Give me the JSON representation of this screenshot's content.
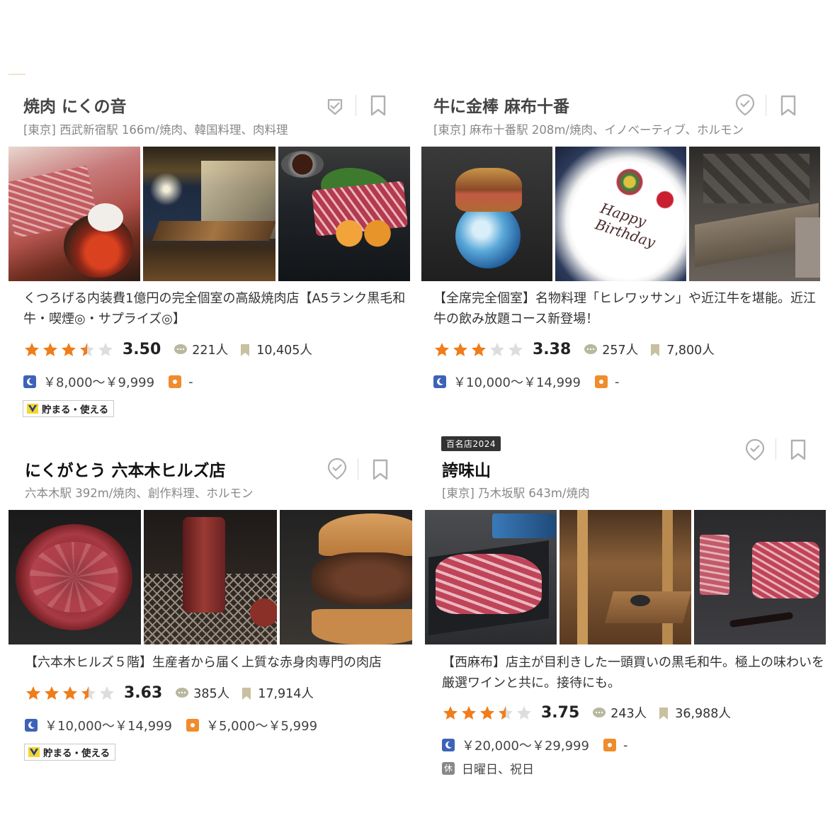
{
  "cards": [
    {
      "title": "焼肉 にくの音",
      "meta": "[東京] 西武新宿駅 166m/焼肉、韓国料理、肉料理",
      "description": "くつろげる内装費1億円の完全個室の高級焼肉店【A5ランク黒毛和牛・喫煙◎・サプライズ◎】",
      "rating": 3.5,
      "score": "3.50",
      "reviews": "221人",
      "bookmarks": "10,405人",
      "dinner_price": "￥8,000～￥9,999",
      "lunch_price": "-",
      "tpoint": "貯まる・使える",
      "photos": [
        "wagyu-plate-photo",
        "private-room-photo",
        "meat-uni-photo"
      ]
    },
    {
      "title": "牛に金棒 麻布十番",
      "meta": "[東京] 麻布十番駅 208m/焼肉、イノベーティブ、ホルモン",
      "description": "【全席完全個室】名物料理「ヒレワッサン」や近江牛を堪能。近江牛の飲み放題コース新登場！",
      "rating": 3.38,
      "score": "3.38",
      "reviews": "257人",
      "bookmarks": "7,800人",
      "dinner_price": "￥10,000～￥14,999",
      "lunch_price": "-",
      "photos": [
        "hirewassan-photo",
        "birthday-plate-photo",
        "dining-table-photo"
      ],
      "plate_text": "Happy Birthday"
    },
    {
      "title": "にくがとう 六本木ヒルズ店",
      "meta": "六本木駅 392m/焼肉、創作料理、ホルモン",
      "description": "【六本木ヒルズ５階】生産者から届く上質な赤身肉専門の肉店",
      "rating": 3.63,
      "score": "3.63",
      "reviews": "385人",
      "bookmarks": "17,914人",
      "dinner_price": "￥10,000～￥14,999",
      "lunch_price": "￥5,000～￥5,999",
      "tpoint": "貯まる・使える",
      "photos": [
        "sliced-beef-photo",
        "grill-photo",
        "burger-photo"
      ]
    },
    {
      "badge": "百名店2024",
      "title": "誇味山",
      "meta": "[東京] 乃木坂駅 643m/焼肉",
      "description": "【西麻布】店主が目利きした一頭買いの黒毛和牛。極上の味わいを厳選ワインと共に。接待にも。",
      "rating": 3.75,
      "score": "3.75",
      "reviews": "243人",
      "bookmarks": "36,988人",
      "dinner_price": "￥20,000～￥29,999",
      "lunch_price": "-",
      "holiday": "日曜日、祝日",
      "photos": [
        "marbled-beef-photo",
        "private-booth-photo",
        "beef-block-photo"
      ]
    }
  ],
  "colors": {
    "star_on": "#f07c1a",
    "star_off": "#dddddd",
    "dinner_icon": "#3d63b8",
    "lunch_icon": "#f08c2c",
    "icon_gray": "#b0b0b0"
  }
}
